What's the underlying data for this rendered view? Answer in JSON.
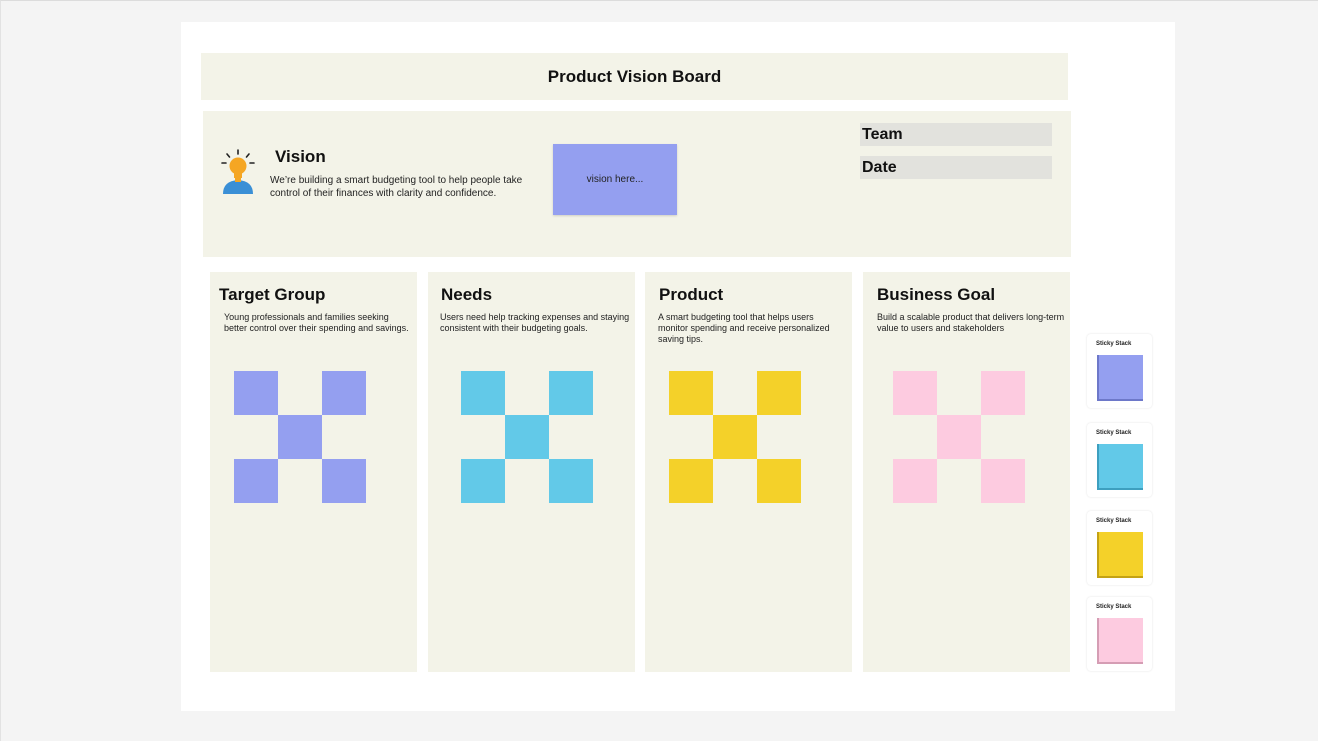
{
  "board": {
    "title": "Product Vision Board"
  },
  "vision": {
    "heading": "Vision",
    "description": "We’re building a smart budgeting tool to help people take control of their finances with clarity and confidence.",
    "sticky_text": "vision here...",
    "icon": "lightbulb-person-icon"
  },
  "fields": {
    "team_label": "Team",
    "date_label": "Date"
  },
  "columns": [
    {
      "heading": "Target Group",
      "text": "Young professionals and families seeking better control over their spending and savings.",
      "color": "#949ff0"
    },
    {
      "heading": "Needs",
      "text": "Users need help tracking expenses and staying consistent with their budgeting goals.",
      "color": "#62c9e8"
    },
    {
      "heading": "Product",
      "text": "A smart budgeting tool that helps users monitor spending and receive personalized saving tips.",
      "color": "#f4d129"
    },
    {
      "heading": "Business Goal",
      "text": "Build a scalable product that delivers long-term value to users and stakeholders",
      "color": "#fdcbe0"
    }
  ],
  "sticky_stacks": [
    {
      "label": "Sticky Stack",
      "color": "#949ff0",
      "edge": "#6d78c9"
    },
    {
      "label": "Sticky Stack",
      "color": "#62c9e8",
      "edge": "#3d9fbf"
    },
    {
      "label": "Sticky Stack",
      "color": "#f4d129",
      "edge": "#c4a214"
    },
    {
      "label": "Sticky Stack",
      "color": "#fdcbe0",
      "edge": "#d59db4"
    }
  ]
}
